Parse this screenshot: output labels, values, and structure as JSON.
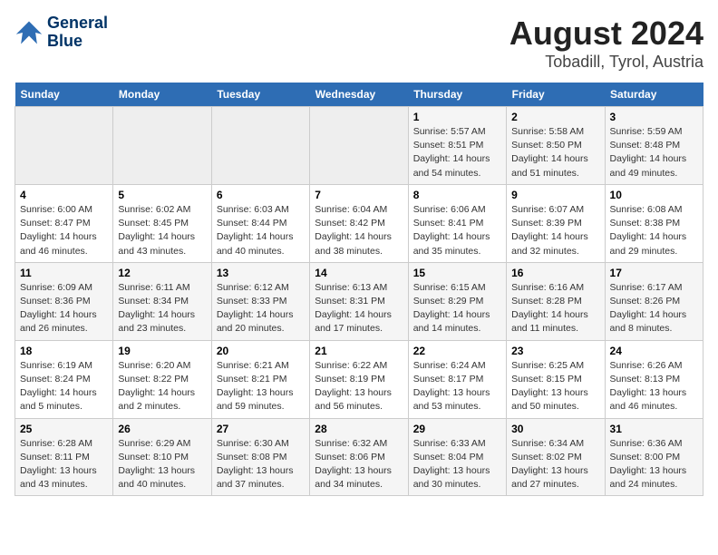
{
  "logo": {
    "line1": "General",
    "line2": "Blue"
  },
  "title": "August 2024",
  "subtitle": "Tobadill, Tyrol, Austria",
  "weekdays": [
    "Sunday",
    "Monday",
    "Tuesday",
    "Wednesday",
    "Thursday",
    "Friday",
    "Saturday"
  ],
  "weeks": [
    [
      {
        "day": "",
        "info": ""
      },
      {
        "day": "",
        "info": ""
      },
      {
        "day": "",
        "info": ""
      },
      {
        "day": "",
        "info": ""
      },
      {
        "day": "1",
        "info": "Sunrise: 5:57 AM\nSunset: 8:51 PM\nDaylight: 14 hours\nand 54 minutes."
      },
      {
        "day": "2",
        "info": "Sunrise: 5:58 AM\nSunset: 8:50 PM\nDaylight: 14 hours\nand 51 minutes."
      },
      {
        "day": "3",
        "info": "Sunrise: 5:59 AM\nSunset: 8:48 PM\nDaylight: 14 hours\nand 49 minutes."
      }
    ],
    [
      {
        "day": "4",
        "info": "Sunrise: 6:00 AM\nSunset: 8:47 PM\nDaylight: 14 hours\nand 46 minutes."
      },
      {
        "day": "5",
        "info": "Sunrise: 6:02 AM\nSunset: 8:45 PM\nDaylight: 14 hours\nand 43 minutes."
      },
      {
        "day": "6",
        "info": "Sunrise: 6:03 AM\nSunset: 8:44 PM\nDaylight: 14 hours\nand 40 minutes."
      },
      {
        "day": "7",
        "info": "Sunrise: 6:04 AM\nSunset: 8:42 PM\nDaylight: 14 hours\nand 38 minutes."
      },
      {
        "day": "8",
        "info": "Sunrise: 6:06 AM\nSunset: 8:41 PM\nDaylight: 14 hours\nand 35 minutes."
      },
      {
        "day": "9",
        "info": "Sunrise: 6:07 AM\nSunset: 8:39 PM\nDaylight: 14 hours\nand 32 minutes."
      },
      {
        "day": "10",
        "info": "Sunrise: 6:08 AM\nSunset: 8:38 PM\nDaylight: 14 hours\nand 29 minutes."
      }
    ],
    [
      {
        "day": "11",
        "info": "Sunrise: 6:09 AM\nSunset: 8:36 PM\nDaylight: 14 hours\nand 26 minutes."
      },
      {
        "day": "12",
        "info": "Sunrise: 6:11 AM\nSunset: 8:34 PM\nDaylight: 14 hours\nand 23 minutes."
      },
      {
        "day": "13",
        "info": "Sunrise: 6:12 AM\nSunset: 8:33 PM\nDaylight: 14 hours\nand 20 minutes."
      },
      {
        "day": "14",
        "info": "Sunrise: 6:13 AM\nSunset: 8:31 PM\nDaylight: 14 hours\nand 17 minutes."
      },
      {
        "day": "15",
        "info": "Sunrise: 6:15 AM\nSunset: 8:29 PM\nDaylight: 14 hours\nand 14 minutes."
      },
      {
        "day": "16",
        "info": "Sunrise: 6:16 AM\nSunset: 8:28 PM\nDaylight: 14 hours\nand 11 minutes."
      },
      {
        "day": "17",
        "info": "Sunrise: 6:17 AM\nSunset: 8:26 PM\nDaylight: 14 hours\nand 8 minutes."
      }
    ],
    [
      {
        "day": "18",
        "info": "Sunrise: 6:19 AM\nSunset: 8:24 PM\nDaylight: 14 hours\nand 5 minutes."
      },
      {
        "day": "19",
        "info": "Sunrise: 6:20 AM\nSunset: 8:22 PM\nDaylight: 14 hours\nand 2 minutes."
      },
      {
        "day": "20",
        "info": "Sunrise: 6:21 AM\nSunset: 8:21 PM\nDaylight: 13 hours\nand 59 minutes."
      },
      {
        "day": "21",
        "info": "Sunrise: 6:22 AM\nSunset: 8:19 PM\nDaylight: 13 hours\nand 56 minutes."
      },
      {
        "day": "22",
        "info": "Sunrise: 6:24 AM\nSunset: 8:17 PM\nDaylight: 13 hours\nand 53 minutes."
      },
      {
        "day": "23",
        "info": "Sunrise: 6:25 AM\nSunset: 8:15 PM\nDaylight: 13 hours\nand 50 minutes."
      },
      {
        "day": "24",
        "info": "Sunrise: 6:26 AM\nSunset: 8:13 PM\nDaylight: 13 hours\nand 46 minutes."
      }
    ],
    [
      {
        "day": "25",
        "info": "Sunrise: 6:28 AM\nSunset: 8:11 PM\nDaylight: 13 hours\nand 43 minutes."
      },
      {
        "day": "26",
        "info": "Sunrise: 6:29 AM\nSunset: 8:10 PM\nDaylight: 13 hours\nand 40 minutes."
      },
      {
        "day": "27",
        "info": "Sunrise: 6:30 AM\nSunset: 8:08 PM\nDaylight: 13 hours\nand 37 minutes."
      },
      {
        "day": "28",
        "info": "Sunrise: 6:32 AM\nSunset: 8:06 PM\nDaylight: 13 hours\nand 34 minutes."
      },
      {
        "day": "29",
        "info": "Sunrise: 6:33 AM\nSunset: 8:04 PM\nDaylight: 13 hours\nand 30 minutes."
      },
      {
        "day": "30",
        "info": "Sunrise: 6:34 AM\nSunset: 8:02 PM\nDaylight: 13 hours\nand 27 minutes."
      },
      {
        "day": "31",
        "info": "Sunrise: 6:36 AM\nSunset: 8:00 PM\nDaylight: 13 hours\nand 24 minutes."
      }
    ]
  ]
}
